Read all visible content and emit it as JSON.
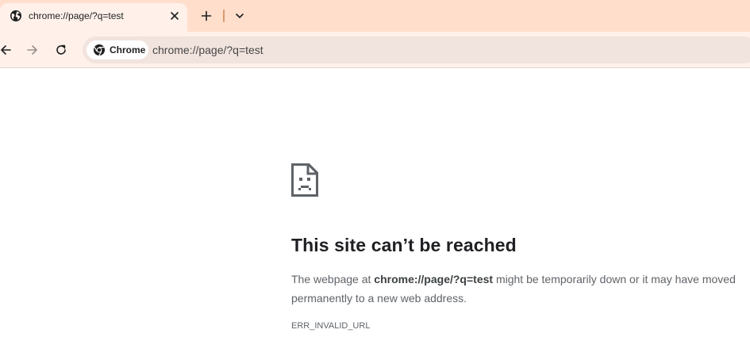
{
  "tab": {
    "title": "chrome://page/?q=test",
    "favicon": "globe-icon"
  },
  "toolbar": {
    "chip_label": "Chrome",
    "url": "chrome://page/?q=test"
  },
  "error": {
    "heading": "This site can’t be reached",
    "body_prefix": "The webpage at ",
    "body_url": "chrome://page/?q=test",
    "body_suffix": " might be temporarily down or it may have moved permanently to a new web address.",
    "code": "ERR_INVALID_URL"
  },
  "colors": {
    "tabstrip": "#ffdfcc",
    "toolbar": "#fff1ea",
    "omnibox": "#f1e3dd"
  }
}
